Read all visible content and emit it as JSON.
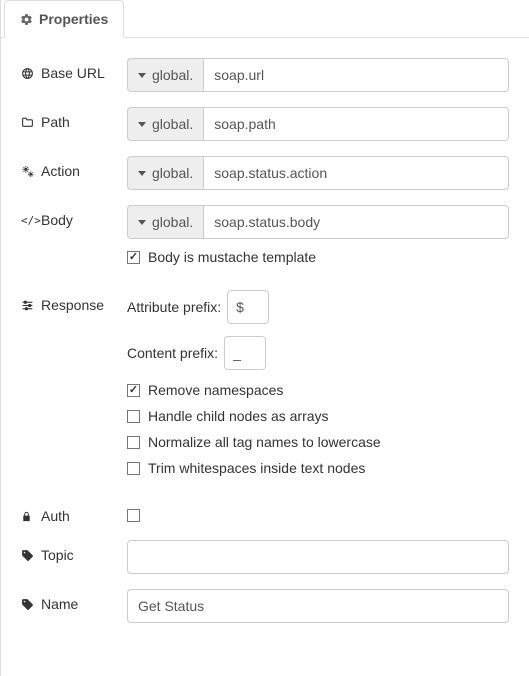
{
  "tab": {
    "label": "Properties"
  },
  "labels": {
    "baseUrl": "Base URL",
    "path": "Path",
    "action": "Action",
    "body": "Body",
    "response": "Response",
    "auth": "Auth",
    "topic": "Topic",
    "name": "Name"
  },
  "addonPrefix": "global.",
  "fields": {
    "baseUrl": "soap.url",
    "path": "soap.path",
    "action": "soap.status.action",
    "body": "soap.status.body",
    "topic": "",
    "name": "Get Status"
  },
  "bodyOptions": {
    "mustacheLabel": "Body is mustache template",
    "mustacheChecked": true
  },
  "response": {
    "attributePrefixLabel": "Attribute prefix:",
    "attributePrefixValue": "$",
    "contentPrefixLabel": "Content prefix:",
    "contentPrefixValue": "_",
    "options": [
      {
        "label": "Remove namespaces",
        "checked": true
      },
      {
        "label": "Handle child nodes as arrays",
        "checked": false
      },
      {
        "label": "Normalize all tag names to lowercase",
        "checked": false
      },
      {
        "label": "Trim whitespaces inside text nodes",
        "checked": false
      }
    ]
  },
  "auth": {
    "checked": false
  }
}
